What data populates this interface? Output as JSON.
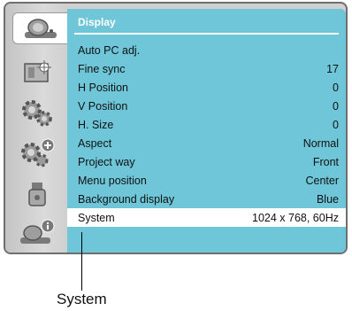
{
  "panel": {
    "title": "Display"
  },
  "sidebar": {
    "icons": [
      {
        "name": "display-icon",
        "active": true
      },
      {
        "name": "color-adjust-icon"
      },
      {
        "name": "setting-gear-icon"
      },
      {
        "name": "expanded-setting-gear-icon"
      },
      {
        "name": "usb-icon"
      },
      {
        "name": "info-icon"
      }
    ]
  },
  "menu": {
    "items": [
      {
        "label": "Auto PC adj.",
        "value": ""
      },
      {
        "label": "Fine sync",
        "value": "17"
      },
      {
        "label": "H Position",
        "value": "0"
      },
      {
        "label": "V Position",
        "value": "0"
      },
      {
        "label": "H. Size",
        "value": "0"
      },
      {
        "label": "Aspect",
        "value": "Normal"
      },
      {
        "label": "Project way",
        "value": "Front"
      },
      {
        "label": "Menu position",
        "value": "Center"
      },
      {
        "label": "Background display",
        "value": "Blue"
      },
      {
        "label": "System",
        "value": "1024 x 768, 60Hz"
      }
    ]
  },
  "callout": {
    "label": "System"
  },
  "colors": {
    "panel": "#6ec6d8",
    "selected_row": "#ffffff",
    "frame": "#6f6f6f"
  }
}
